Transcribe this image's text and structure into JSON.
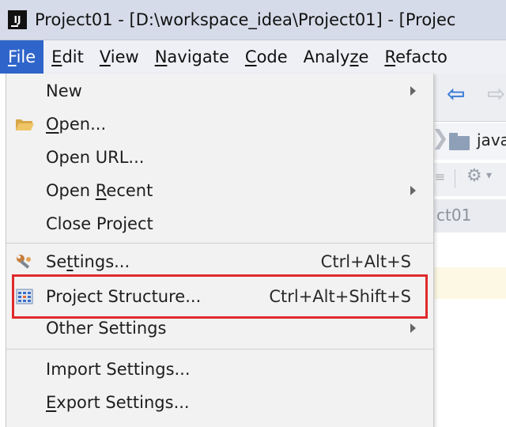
{
  "window": {
    "title": "Project01 - [D:\\workspace_idea\\Project01] - [Projec",
    "app_icon_text": "IJ"
  },
  "menubar": {
    "items": [
      {
        "label": "File",
        "mnemonic": "F",
        "rest": "ile",
        "active": true
      },
      {
        "label": "Edit",
        "mnemonic": "E",
        "rest": "dit"
      },
      {
        "label": "View",
        "mnemonic": "V",
        "rest": "iew"
      },
      {
        "label": "Navigate",
        "mnemonic": "N",
        "rest": "avigate"
      },
      {
        "label": "Code",
        "mnemonic": "C",
        "rest": "ode"
      },
      {
        "label": "Analyze",
        "pre": "Analy",
        "mnemonic": "z",
        "rest": "e"
      },
      {
        "label": "Refacto",
        "mnemonic": "R",
        "rest": "efacto"
      }
    ]
  },
  "file_menu": {
    "new": {
      "label": "New"
    },
    "open": {
      "mnemonic": "O",
      "rest": "pen...",
      "icon": "folder-open-icon"
    },
    "open_url": {
      "label": "Open URL..."
    },
    "open_recent": {
      "pre": "Open ",
      "mnemonic": "R",
      "rest": "ecent"
    },
    "close_project": {
      "label": "Close Project"
    },
    "settings": {
      "pre": "Se",
      "mnemonic": "t",
      "rest": "tings...",
      "shortcut": "Ctrl+Alt+S",
      "icon": "wrench-icon"
    },
    "project_structure": {
      "label": "Project Structure...",
      "shortcut": "Ctrl+Alt+Shift+S",
      "icon": "project-structure-icon"
    },
    "other_settings": {
      "label": "Other Settings"
    },
    "import_settings": {
      "label": "Import Settings..."
    },
    "export_settings": {
      "mnemonic": "E",
      "rest": "xport Settings..."
    }
  },
  "background": {
    "breadcrumb_folder": "java",
    "project_tab": "ct01"
  },
  "colors": {
    "accent": "#2f65ca",
    "highlight": "#e0292c"
  }
}
